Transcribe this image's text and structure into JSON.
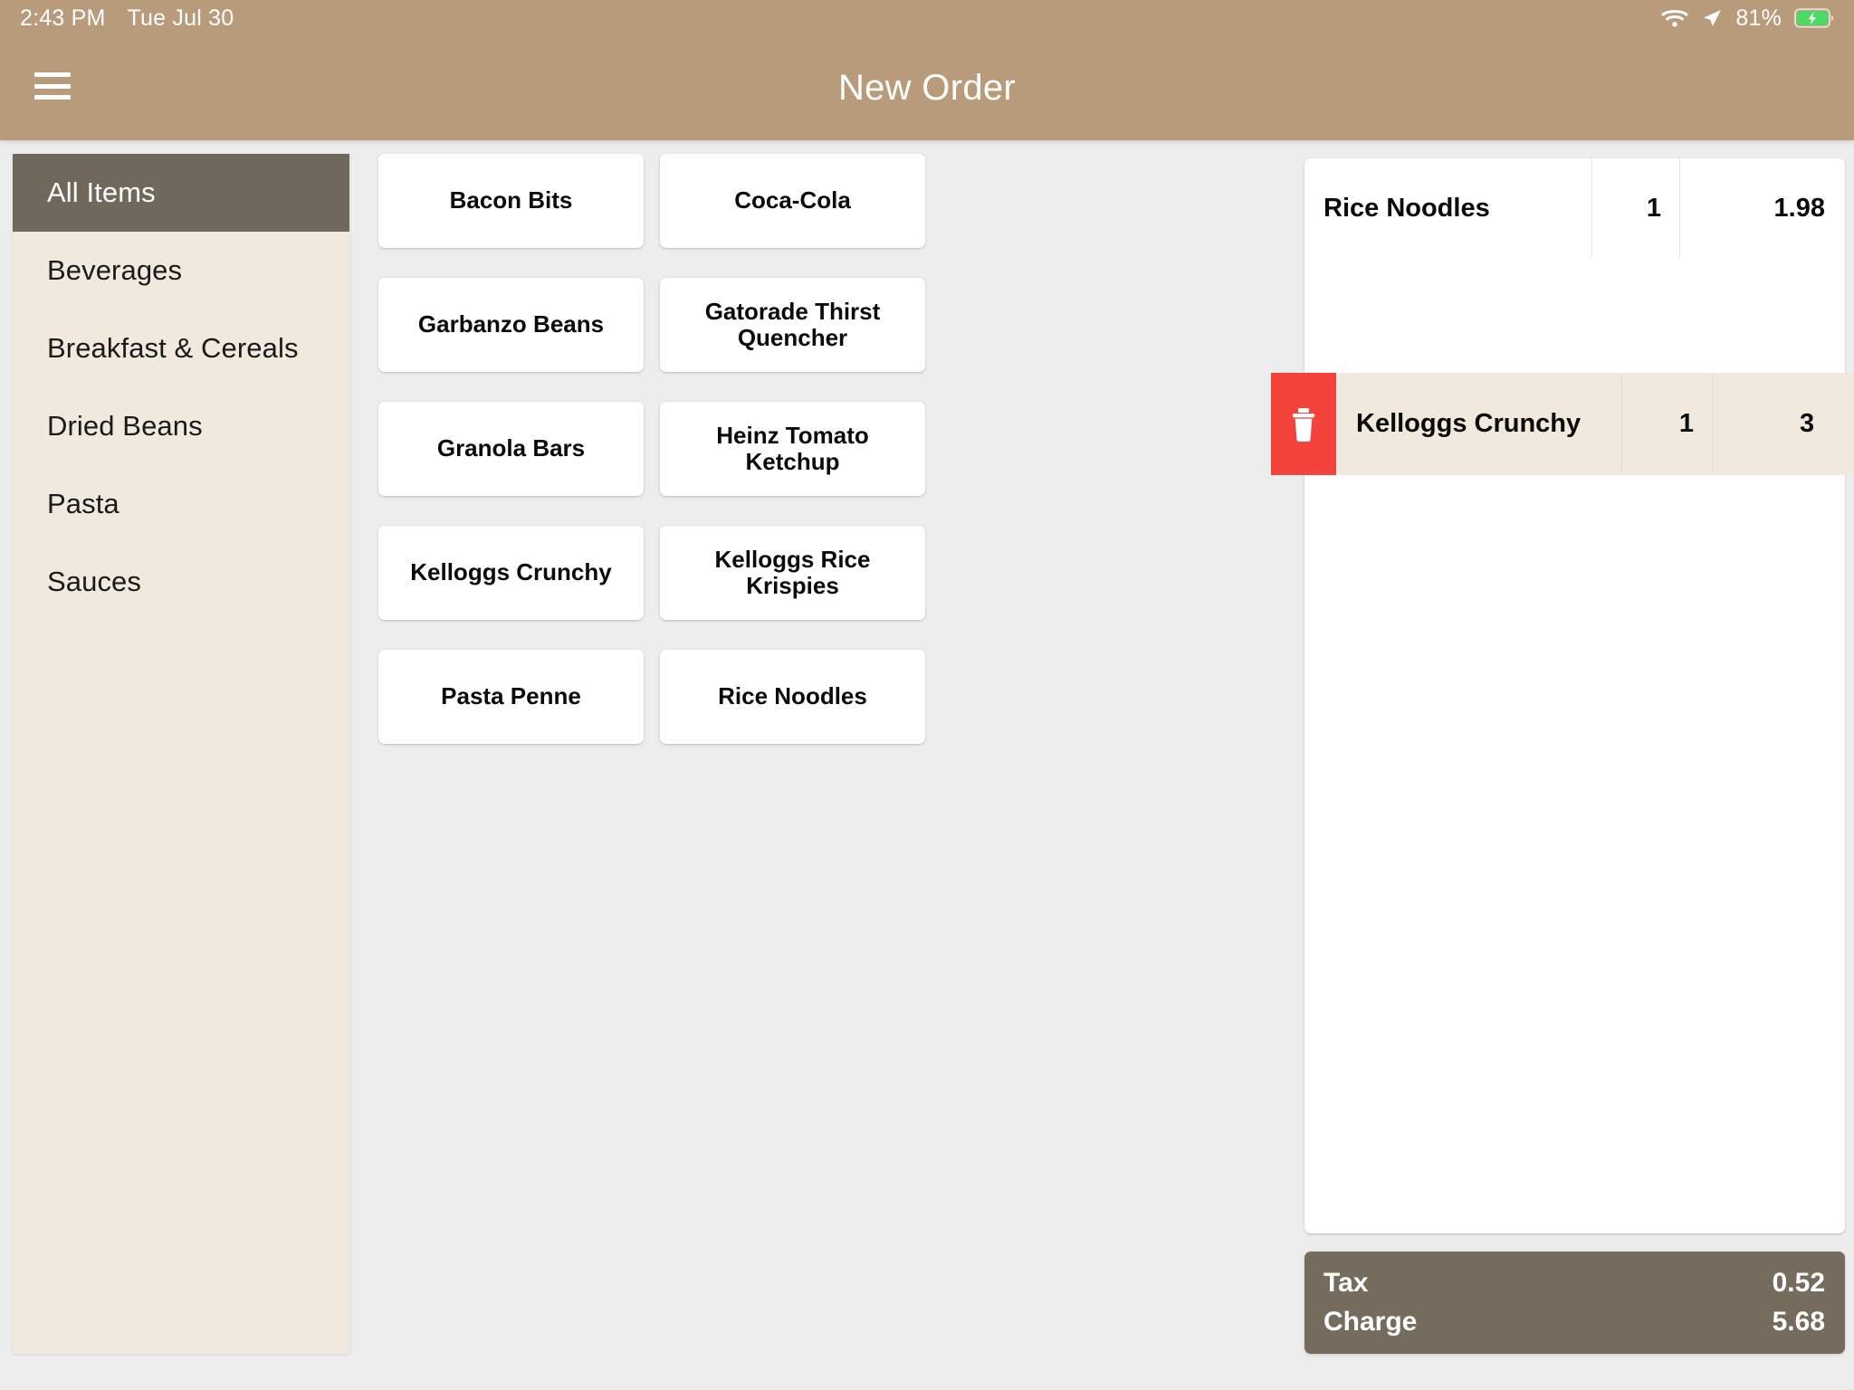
{
  "status_bar": {
    "time": "2:43 PM",
    "date": "Tue Jul 30",
    "battery_percent": "81%",
    "wifi_icon": "wifi-icon",
    "location_icon": "location-arrow-icon",
    "battery_icon": "battery-charging-icon",
    "battery_color": "#4CD964"
  },
  "nav": {
    "menu_icon": "hamburger-menu-icon",
    "title": "New Order",
    "bar_color": "#B89B7B"
  },
  "sidebar": {
    "background_color": "#F1E9DD",
    "selected_color": "#6F685B",
    "categories": [
      {
        "label": "All Items",
        "selected": true
      },
      {
        "label": "Beverages",
        "selected": false
      },
      {
        "label": "Breakfast & Cereals",
        "selected": false
      },
      {
        "label": "Dried Beans",
        "selected": false
      },
      {
        "label": "Pasta",
        "selected": false
      },
      {
        "label": "Sauces",
        "selected": false
      }
    ]
  },
  "item_grid": {
    "items": [
      {
        "name": "Bacon Bits"
      },
      {
        "name": "Coca-Cola"
      },
      {
        "name": "Garbanzo Beans"
      },
      {
        "name": "Gatorade Thirst Quencher"
      },
      {
        "name": "Granola Bars"
      },
      {
        "name": "Heinz Tomato Ketchup"
      },
      {
        "name": "Kelloggs Crunchy"
      },
      {
        "name": "Kelloggs Rice Krispies"
      },
      {
        "name": "Pasta Penne"
      },
      {
        "name": "Rice Noodles"
      }
    ]
  },
  "order": {
    "lines": [
      {
        "name": "Rice Noodles",
        "qty": "1",
        "price": "1.98",
        "swiped": false
      },
      {
        "name": "Kelloggs Crunchy",
        "qty": "1",
        "price": "3",
        "swiped": true
      }
    ],
    "delete_icon": "trash-icon",
    "delete_color": "#F4433A",
    "swiped_row_color": "#F1E9DD"
  },
  "totals": {
    "background_color": "#756C5E",
    "tax_label": "Tax",
    "tax_value": "0.52",
    "charge_label": "Charge",
    "charge_value": "5.68"
  }
}
